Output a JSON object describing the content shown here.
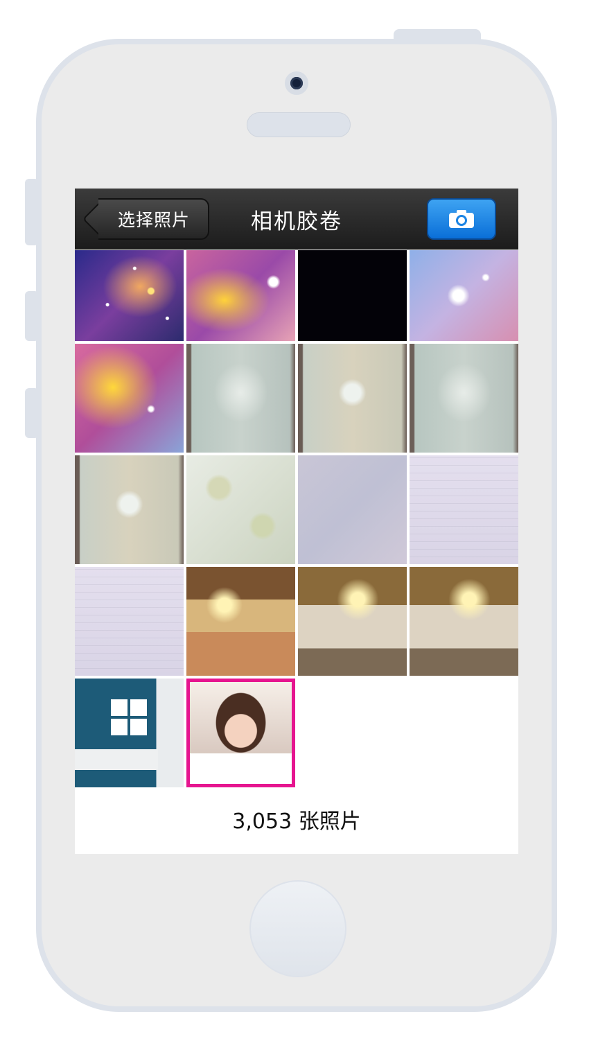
{
  "nav": {
    "back_label": "选择照片",
    "title": "相机胶卷",
    "camera_icon": "camera-icon"
  },
  "photos": [
    {
      "kind": "galaxy-a"
    },
    {
      "kind": "galaxy-b"
    },
    {
      "kind": "black"
    },
    {
      "kind": "galaxy-c"
    },
    {
      "kind": "galaxy-d"
    },
    {
      "kind": "wallpaper"
    },
    {
      "kind": "wallpaper-b"
    },
    {
      "kind": "wallpaper"
    },
    {
      "kind": "wallpaper-b"
    },
    {
      "kind": "floral"
    },
    {
      "kind": "plain"
    },
    {
      "kind": "doc"
    },
    {
      "kind": "doc"
    },
    {
      "kind": "bed"
    },
    {
      "kind": "bed-b"
    },
    {
      "kind": "bed-b"
    },
    {
      "kind": "living"
    },
    {
      "kind": "portrait",
      "selected": true
    }
  ],
  "footer": {
    "photo_count": "3,053 张照片"
  },
  "colors": {
    "selection": "#e6158f",
    "camera_button": "#1b84e4"
  }
}
